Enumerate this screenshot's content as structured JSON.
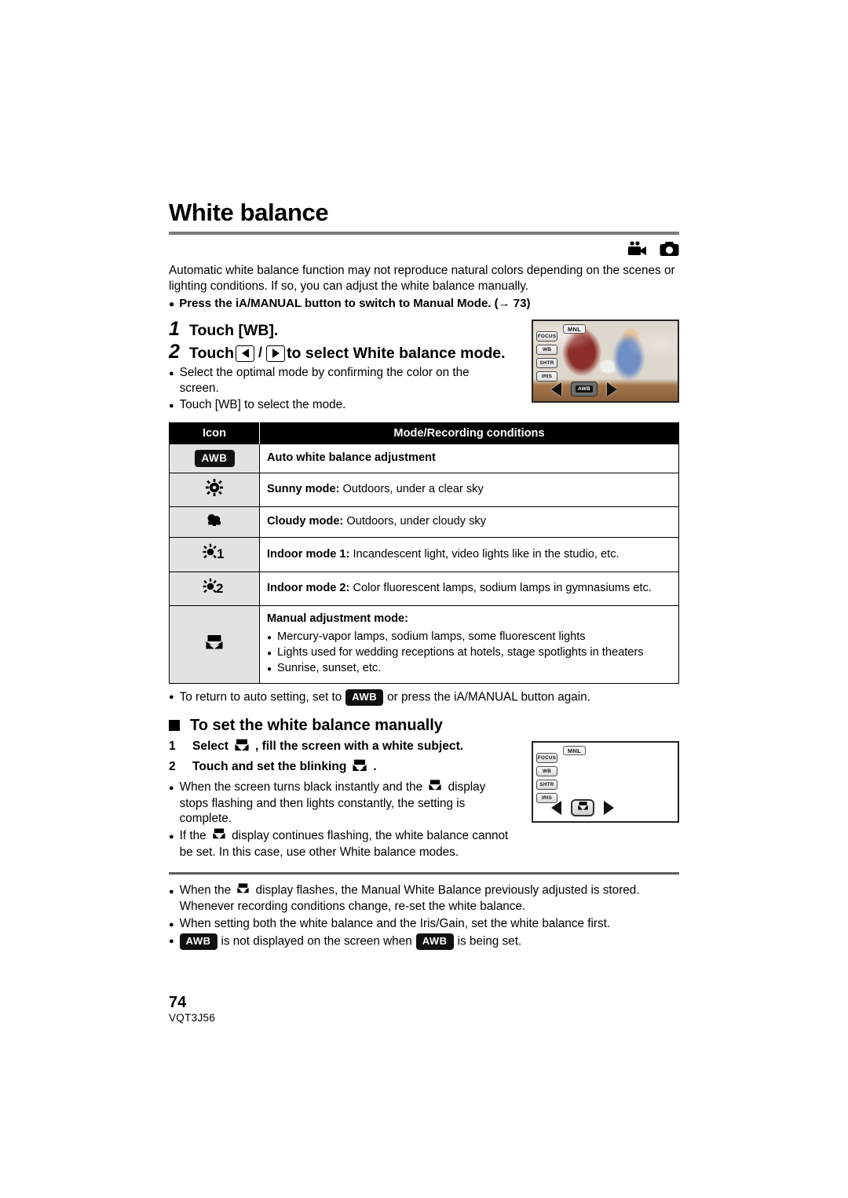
{
  "page": {
    "title": "White balance",
    "number": "74",
    "code": "VQT3J56"
  },
  "mode_icons": [
    {
      "name": "video-camera-icon",
      "label": "Motion Picture Recording Mode"
    },
    {
      "name": "still-camera-icon",
      "label": "Still Picture Recording Mode"
    }
  ],
  "intro": {
    "paragraph": "Automatic white balance function may not reproduce natural colors depending on the scenes or lighting conditions. If so, you can adjust the white balance manually.",
    "note": "Press the iA/MANUAL button to switch to Manual Mode. (→ 73)"
  },
  "steps": [
    {
      "number": "1",
      "text_before": "Touch [WB].",
      "text_after": "",
      "has_keys": false
    },
    {
      "number": "2",
      "text_before": "Touch",
      "text_after": "to select White balance mode.",
      "has_keys": true
    }
  ],
  "step_bullets": [
    "Select the optimal mode by confirming the color on the screen.",
    "Touch [WB] to select the mode."
  ],
  "lcd_screen_1": {
    "mnl_label": "MNL",
    "side_buttons": [
      "FOCUS",
      "WB",
      "SHTR",
      "IRIS"
    ],
    "center_button": "AWB",
    "left_arrow": "◀",
    "right_arrow": "▶"
  },
  "lcd_screen_2": {
    "mnl_label": "MNL",
    "side_buttons": [
      "FOCUS",
      "WB",
      "SHTR",
      "IRIS"
    ],
    "center_button_icon": "manual-white-balance-icon",
    "left_arrow": "◀",
    "right_arrow": "▶"
  },
  "table": {
    "headers": [
      "Icon",
      "Mode/Recording conditions"
    ],
    "rows": [
      {
        "icon": "awb-badge",
        "icon_text": "AWB",
        "lead": "Auto white balance adjustment",
        "rest": ""
      },
      {
        "icon": "sunny-icon",
        "icon_text": "",
        "lead": "Sunny mode:",
        "rest": " Outdoors, under a clear sky"
      },
      {
        "icon": "cloudy-icon",
        "icon_text": "",
        "lead": "Cloudy mode:",
        "rest": " Outdoors, under cloudy sky"
      },
      {
        "icon": "indoor-1-icon",
        "icon_text": "",
        "lead": "Indoor mode 1:",
        "rest": " Incandescent light, video lights like in the studio, etc."
      },
      {
        "icon": "indoor-2-icon",
        "icon_text": "",
        "lead": "Indoor mode 2:",
        "rest": " Color fluorescent lamps, sodium lamps in gymnasiums etc."
      },
      {
        "icon": "manual-white-balance-icon",
        "icon_text": "",
        "lead": "Manual adjustment mode:",
        "rest": "",
        "sub_items": [
          "Mercury-vapor lamps, sodium lamps, some fluorescent lights",
          "Lights used for wedding receptions at hotels, stage spotlights in theaters",
          "Sunrise, sunset, etc."
        ]
      }
    ]
  },
  "after_table_note": {
    "before": "To return to auto setting, set to",
    "badge": "AWB",
    "after": "or press the iA/MANUAL button again."
  },
  "manual_section": {
    "heading": "To set the white balance manually",
    "steps": [
      {
        "number": "1",
        "before": "Select",
        "after": ", fill the screen with a white subject."
      },
      {
        "number": "2",
        "before": "Touch and set the blinking",
        "after": "."
      }
    ],
    "bullets": [
      {
        "before": "When the screen turns black instantly and the",
        "after": "display stops flashing and then lights constantly, the setting is complete."
      },
      {
        "before": "If the",
        "after": "display continues flashing, the white balance cannot be set. In this case, use other White balance modes."
      }
    ]
  },
  "notes": [
    {
      "type": "icon-text",
      "before": "When the",
      "after": "display flashes, the Manual White Balance previously adjusted is stored. Whenever recording conditions change, re-set the white balance."
    },
    {
      "type": "text",
      "text": "When setting both the white balance and the Iris/Gain, set the white balance first."
    },
    {
      "type": "badge-badge",
      "badge1": "AWB",
      "middle": "is not displayed on the screen when",
      "badge2": "AWB",
      "after": "is being set."
    }
  ]
}
